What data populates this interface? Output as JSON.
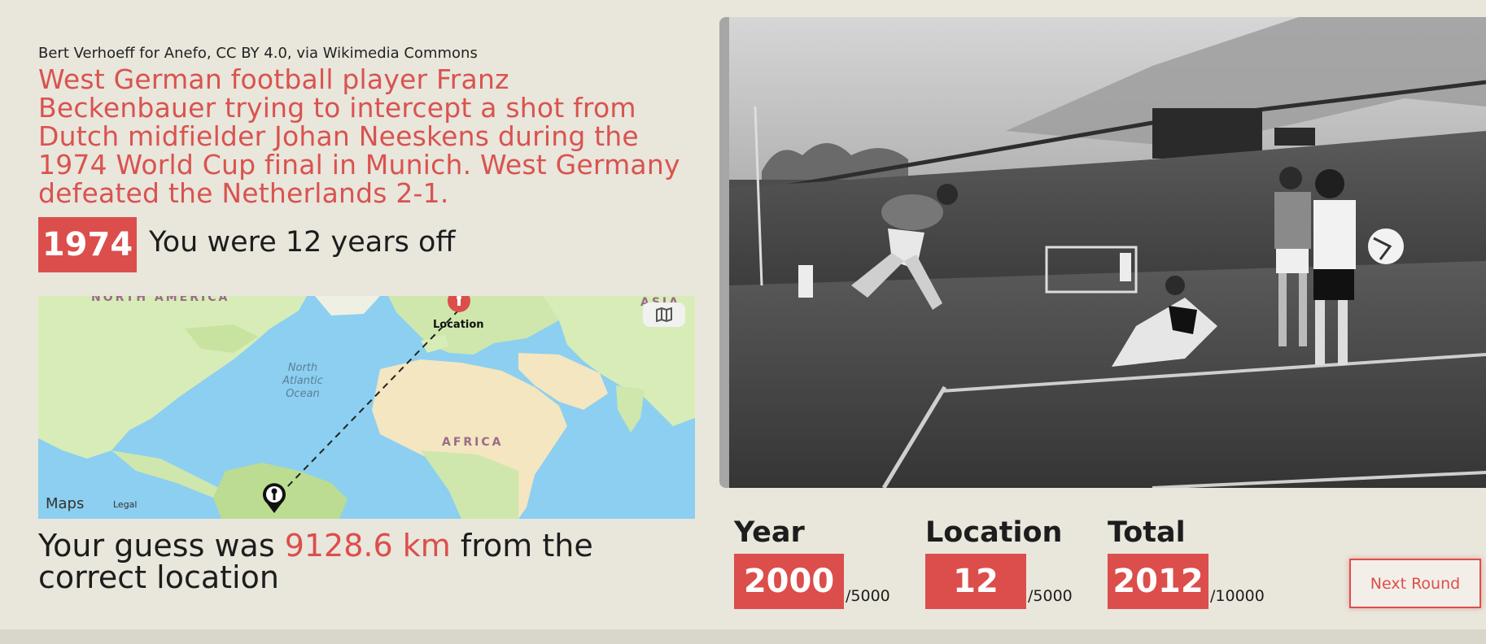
{
  "photo": {
    "credit": "Bert Verhoeff for Anefo, CC BY 4.0, via Wikimedia Commons",
    "caption": "West German football player Franz Beckenbauer trying to intercept a shot from Dutch midfielder Johan Neeskens during the 1974 World Cup final in Munich. West Germany defeated the Netherlands 2-1."
  },
  "year_result": {
    "year": "1974",
    "message": "You were 12 years off"
  },
  "map": {
    "labels": {
      "north_america": "NORTH AMERICA",
      "asia": "ASIA",
      "africa": "AFRICA",
      "ocean": "North Atlantic Ocean",
      "location": "Location"
    },
    "logo": "Maps",
    "legal": "Legal",
    "colors": {
      "water": "#8ccff0",
      "land": "#d8ecb8",
      "correct_pin": "#dc4e4b",
      "guess_pin": "#111111"
    }
  },
  "distance": {
    "prefix": "Your guess was ",
    "value": "9128.6 km",
    "suffix": " from the correct location"
  },
  "scores": {
    "year": {
      "label": "Year",
      "value": "2000",
      "max": "/5000"
    },
    "location": {
      "label": "Location",
      "value": "12",
      "max": "/5000"
    },
    "total": {
      "label": "Total",
      "value": "2012",
      "max": "/10000"
    }
  },
  "next_button": {
    "label": "Next Round"
  },
  "theme": {
    "accent": "#dc4e4b",
    "background": "#e9e6dc",
    "text": "#1d1d1d"
  }
}
